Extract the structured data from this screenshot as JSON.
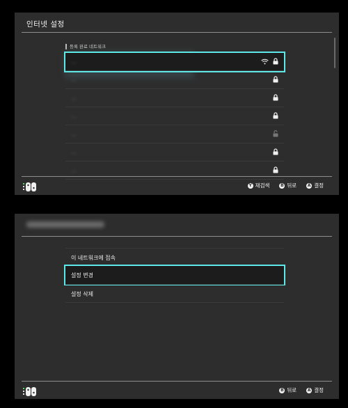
{
  "screen1": {
    "title": "인터넷 설정",
    "section_label": "등록 완료 네트워크",
    "networks": [
      {
        "name": "...",
        "wifi": true,
        "lock": true,
        "lock_open": false,
        "selected": true
      },
      {
        "name": "...",
        "wifi": false,
        "lock": true,
        "lock_open": false,
        "selected": false
      },
      {
        "name": "...",
        "wifi": false,
        "lock": true,
        "lock_open": false,
        "selected": false
      },
      {
        "name": "...",
        "wifi": false,
        "lock": true,
        "lock_open": false,
        "selected": false
      },
      {
        "name": "...",
        "wifi": false,
        "lock": false,
        "lock_open": true,
        "selected": false
      },
      {
        "name": "...",
        "wifi": false,
        "lock": true,
        "lock_open": false,
        "selected": false
      },
      {
        "name": "...",
        "wifi": false,
        "lock": true,
        "lock_open": false,
        "selected": false
      }
    ],
    "footer": {
      "hints": [
        {
          "button": "Y",
          "label": "재검색"
        },
        {
          "button": "B",
          "label": "뒤로"
        },
        {
          "button": "A",
          "label": "결정"
        }
      ]
    }
  },
  "screen2": {
    "menu": [
      {
        "label": "이 네트워크에 접속",
        "selected": false
      },
      {
        "label": "설정 변경",
        "selected": true
      },
      {
        "label": "설정 삭제",
        "selected": false
      }
    ],
    "footer": {
      "hints": [
        {
          "button": "B",
          "label": "뒤로"
        },
        {
          "button": "A",
          "label": "결정"
        }
      ]
    }
  },
  "colors": {
    "accent": "#5fe8e8",
    "background": "#2d2d2d",
    "text": "#e8e8e8"
  }
}
